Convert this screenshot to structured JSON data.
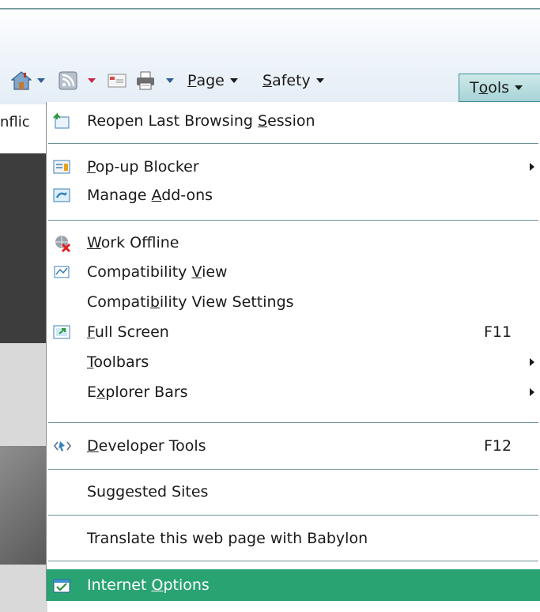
{
  "toolbar": {
    "home_icon": "home-icon",
    "feeds_icon": "rss-feeds-icon",
    "mail_icon": "mail-icon",
    "print_icon": "print-icon",
    "page_label": "Page",
    "safety_label": "Safety",
    "tools_label": "Tools",
    "page_access": "P",
    "page_rest": "age",
    "safety_access": "S",
    "safety_rest": "afety",
    "tools_pre": "T",
    "tools_access": "o",
    "tools_rest": "ols"
  },
  "background": {
    "partial_text": "nflic"
  },
  "menu": {
    "items": [
      {
        "label_pre": "Reopen Last Browsing ",
        "access": "S",
        "label_post": "ession",
        "icon": "reopen-session-icon"
      },
      {
        "label_pre": "",
        "access": "P",
        "label_post": "op-up Blocker",
        "icon": "popup-blocker-icon"
      },
      {
        "label_pre": "Manage ",
        "access": "A",
        "label_post": "dd-ons",
        "icon": "addons-icon"
      },
      {
        "label_pre": "",
        "access": "W",
        "label_post": "ork Offline",
        "icon": "work-offline-icon"
      },
      {
        "label_pre": "Compatibility ",
        "access": "V",
        "label_post": "iew",
        "icon": "compatibility-view-icon"
      },
      {
        "label_pre": "Compati",
        "access": "b",
        "label_post": "ility View Settings"
      },
      {
        "label_pre": "",
        "access": "F",
        "label_post": "ull Screen",
        "shortcut": "F11",
        "icon": "full-screen-icon"
      },
      {
        "label_pre": "",
        "access": "T",
        "label_post": "oolbars"
      },
      {
        "label_pre": "E",
        "access": "x",
        "label_post": "plorer Bars"
      },
      {
        "label_pre": "",
        "access": "D",
        "label_post": "eveloper Tools",
        "shortcut": "F12",
        "icon": "developer-tools-icon"
      },
      {
        "label_pre": "Su",
        "access": "g",
        "label_post": "gested Sites"
      },
      {
        "label_pre": "Translate this web page with Babylon",
        "access": "",
        "label_post": ""
      },
      {
        "label_pre": "Internet ",
        "access": "O",
        "label_post": "ptions",
        "icon": "internet-options-icon"
      }
    ]
  },
  "colors": {
    "highlight": "#2aa373",
    "separator": "#6c9196",
    "tools_button": "#a7d3d6"
  }
}
